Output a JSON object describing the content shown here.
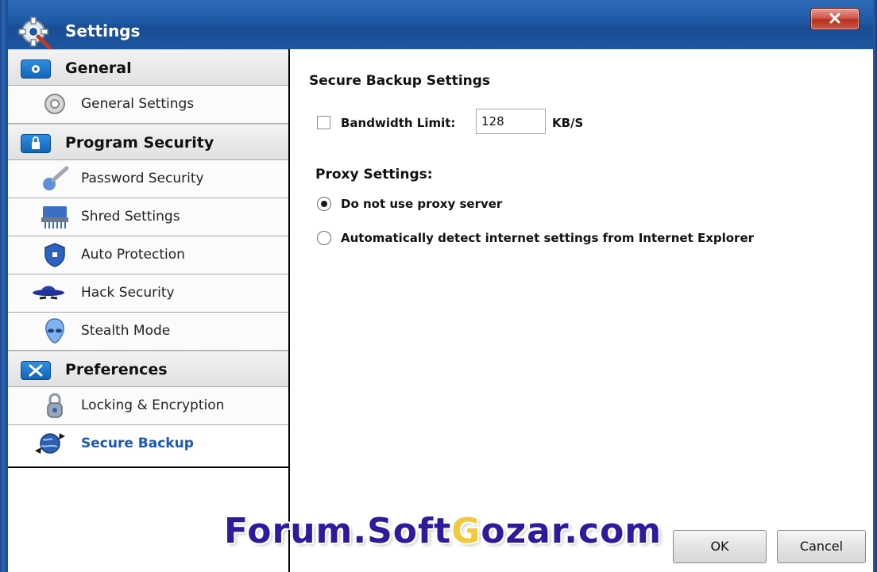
{
  "window": {
    "title": "Settings",
    "close_label": "X"
  },
  "sidebar": {
    "sections": [
      {
        "label": "General",
        "icon": "gear-folder-icon",
        "items": [
          {
            "label": "General Settings",
            "icon": "gear-icon"
          }
        ]
      },
      {
        "label": "Program Security",
        "icon": "lock-folder-icon",
        "items": [
          {
            "label": "Password Security",
            "icon": "key-icon"
          },
          {
            "label": "Shred Settings",
            "icon": "shredder-icon"
          },
          {
            "label": "Auto Protection",
            "icon": "shield-icon"
          },
          {
            "label": "Hack Security",
            "icon": "spy-hat-icon"
          },
          {
            "label": "Stealth Mode",
            "icon": "alien-icon"
          }
        ]
      },
      {
        "label": "Preferences",
        "icon": "tools-folder-icon",
        "items": [
          {
            "label": "Locking & Encryption",
            "icon": "padlock-icon"
          },
          {
            "label": "Secure Backup",
            "icon": "globe-sync-icon",
            "selected": true
          }
        ]
      }
    ]
  },
  "content": {
    "section_title": "Secure Backup Settings",
    "bandwidth": {
      "label": "Bandwidth Limit:",
      "value": "128",
      "unit": "KB/S",
      "checked": false
    },
    "proxy": {
      "title": "Proxy Settings:",
      "options": [
        {
          "label": "Do not use proxy server",
          "checked": true
        },
        {
          "label": "Automatically detect internet settings from Internet Explorer",
          "checked": false
        }
      ]
    }
  },
  "buttons": {
    "ok": "OK",
    "cancel": "Cancel"
  },
  "watermark": {
    "part1": "Forum.Soft",
    "part2": "G",
    "part3": "ozar.com"
  },
  "colors": {
    "titlebar": "#1e58a4",
    "selected_item_text": "#1c58b0",
    "watermark": "#2c1b9c",
    "watermark_accent": "#f2c93a"
  }
}
